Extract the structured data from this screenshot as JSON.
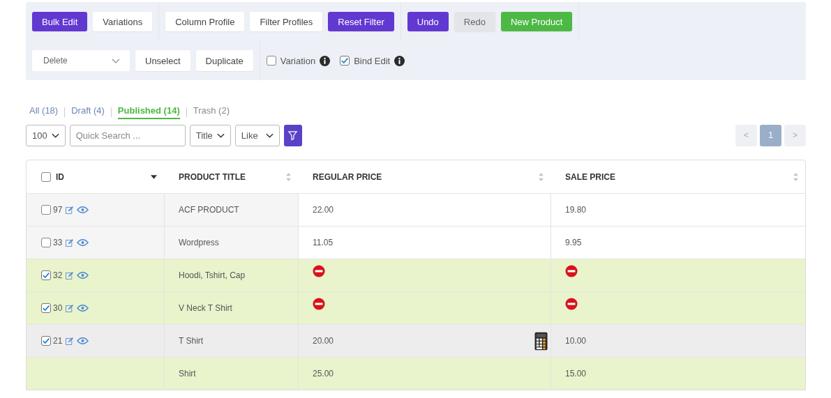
{
  "toolbar": {
    "groups": [
      [
        {
          "label": "Bulk Edit",
          "kind": "primary"
        },
        {
          "label": "Variations",
          "kind": "default"
        }
      ],
      [
        {
          "label": "Column Profile",
          "kind": "default"
        },
        {
          "label": "Filter Profiles",
          "kind": "default"
        },
        {
          "label": "Reset Filter",
          "kind": "primary"
        }
      ],
      [
        {
          "label": "Undo",
          "kind": "primary"
        },
        {
          "label": "Redo",
          "kind": "disabled"
        },
        {
          "label": "New Product",
          "kind": "success"
        }
      ]
    ],
    "bulk_action": {
      "value": "Delete"
    },
    "actions": [
      {
        "label": "Unselect"
      },
      {
        "label": "Duplicate"
      }
    ],
    "options": [
      {
        "label": "Variation",
        "checked": false
      },
      {
        "label": "Bind Edit",
        "checked": true
      }
    ]
  },
  "status_tabs": [
    {
      "label": "All (18)",
      "selected": false
    },
    {
      "label": "Draft (4)",
      "selected": false
    },
    {
      "label": "Published (14)",
      "selected": true
    },
    {
      "label": "Trash (2)",
      "selected": false
    }
  ],
  "filters": {
    "per_page": "100",
    "search": {
      "placeholder": "Quick Search ..."
    },
    "field": "Title",
    "operator": "Like"
  },
  "pagination": {
    "prev": "<",
    "pages": [
      {
        "label": "1",
        "selected": true
      }
    ],
    "next": ">"
  },
  "table": {
    "select_all": {
      "checked": false
    },
    "columns": [
      {
        "label": "ID",
        "kind": "sorted"
      },
      {
        "label": "PRODUCT TITLE",
        "kind": "sortable"
      },
      {
        "label": "REGULAR PRICE",
        "kind": "sortable"
      },
      {
        "label": "SALE PRICE",
        "kind": "sortable"
      }
    ],
    "rows": [
      {
        "id": "97",
        "checked": false,
        "hovered": false,
        "title": "ACF PRODUCT",
        "regular_price": {
          "kind": "text",
          "value": "22.00"
        },
        "sale_price": {
          "kind": "text",
          "value": "19.80"
        },
        "calculator": false
      },
      {
        "id": "33",
        "checked": false,
        "hovered": false,
        "title": "Wordpress",
        "regular_price": {
          "kind": "text",
          "value": "11.05"
        },
        "sale_price": {
          "kind": "text",
          "value": "9.95"
        },
        "calculator": false
      },
      {
        "id": "32",
        "checked": true,
        "hovered": false,
        "title": "Hoodi, Tshirt, Cap",
        "regular_price": {
          "kind": "blocked"
        },
        "sale_price": {
          "kind": "blocked"
        },
        "calculator": false
      },
      {
        "id": "30",
        "checked": true,
        "hovered": false,
        "title": "V Neck T Shirt",
        "regular_price": {
          "kind": "blocked"
        },
        "sale_price": {
          "kind": "blocked"
        },
        "calculator": false
      },
      {
        "id": "21",
        "checked": true,
        "hovered": true,
        "title": "T Shirt",
        "regular_price": {
          "kind": "text",
          "value": "20.00"
        },
        "sale_price": {
          "kind": "text",
          "value": "10.00"
        },
        "calculator": true
      },
      {
        "checked": true,
        "hovered": false,
        "title": "Shirt",
        "regular_price": {
          "kind": "text",
          "value": "25.00"
        },
        "sale_price": {
          "kind": "text",
          "value": "15.00"
        },
        "calculator": false
      }
    ]
  }
}
